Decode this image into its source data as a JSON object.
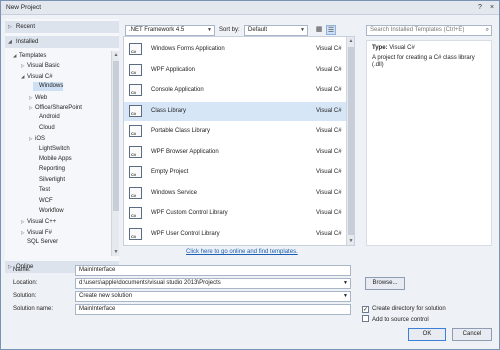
{
  "window": {
    "title": "New Project",
    "help_glyph": "?",
    "close_glyph": "×"
  },
  "left_panel": {
    "recent_label": "Recent",
    "installed_label": "Installed",
    "online_label": "Online",
    "tree": [
      {
        "label": "Templates",
        "expander": "◢"
      },
      {
        "label": "Visual Basic",
        "expander": "▷"
      },
      {
        "label": "Visual C#",
        "expander": "◢"
      },
      {
        "label": "Windows",
        "expander": "",
        "selected": true
      },
      {
        "label": "Web",
        "expander": "▷"
      },
      {
        "label": "Office/SharePoint",
        "expander": "▷"
      },
      {
        "label": "Android",
        "expander": ""
      },
      {
        "label": "Cloud",
        "expander": ""
      },
      {
        "label": "iOS",
        "expander": "▷"
      },
      {
        "label": "LightSwitch",
        "expander": ""
      },
      {
        "label": "Mobile Apps",
        "expander": ""
      },
      {
        "label": "Reporting",
        "expander": ""
      },
      {
        "label": "Silverlight",
        "expander": ""
      },
      {
        "label": "Test",
        "expander": ""
      },
      {
        "label": "WCF",
        "expander": ""
      },
      {
        "label": "Workflow",
        "expander": ""
      },
      {
        "label": "Visual C++",
        "expander": "▷"
      },
      {
        "label": "Visual F#",
        "expander": "▷"
      },
      {
        "label": "SQL Server",
        "expander": ""
      }
    ]
  },
  "toolbar": {
    "framework": ".NET Framework 4.5",
    "sort_label": "Sort by:",
    "sort_value": "Default",
    "view_small_icon": "▦",
    "view_list_icon": "☰"
  },
  "search": {
    "placeholder": "Search Installed Templates (Ctrl+E)",
    "icon": "search-icon"
  },
  "templates": [
    {
      "name": "Windows Forms Application",
      "lang": "Visual C#",
      "icon": "winforms-icon"
    },
    {
      "name": "WPF Application",
      "lang": "Visual C#",
      "icon": "wpf-icon"
    },
    {
      "name": "Console Application",
      "lang": "Visual C#",
      "icon": "console-icon"
    },
    {
      "name": "Class Library",
      "lang": "Visual C#",
      "icon": "class-library-icon",
      "selected": true
    },
    {
      "name": "Portable Class Library",
      "lang": "Visual C#",
      "icon": "portable-library-icon"
    },
    {
      "name": "WPF Browser Application",
      "lang": "Visual C#",
      "icon": "wpf-browser-icon"
    },
    {
      "name": "Empty Project",
      "lang": "Visual C#",
      "icon": "empty-project-icon"
    },
    {
      "name": "Windows Service",
      "lang": "Visual C#",
      "icon": "windows-service-icon"
    },
    {
      "name": "WPF Custom Control Library",
      "lang": "Visual C#",
      "icon": "wpf-custom-control-icon"
    },
    {
      "name": "WPF User Control Library",
      "lang": "Visual C#",
      "icon": "wpf-user-control-icon"
    }
  ],
  "online_link": "Click here to go online and find templates.",
  "description": {
    "type_label": "Type:",
    "type_value": "Visual C#",
    "text": "A project for creating a C# class library (.dll)"
  },
  "form": {
    "name_label": "Name:",
    "name_value": "MainInterface",
    "location_label": "Location:",
    "location_value": "d:\\users\\apple\\documents\\visual studio 2013\\Projects",
    "solution_label": "Solution:",
    "solution_value": "Create new solution",
    "solution_name_label": "Solution name:",
    "solution_name_value": "MainInterface",
    "browse_label": "Browse...",
    "create_dir_label": "Create directory for solution",
    "create_dir_checked": true,
    "source_control_label": "Add to source control",
    "source_control_checked": false,
    "ok_label": "OK",
    "cancel_label": "Cancel"
  },
  "colors": {
    "accent": "#3c7fd6",
    "selection": "#d7e6f7",
    "link": "#1a5fb4"
  }
}
